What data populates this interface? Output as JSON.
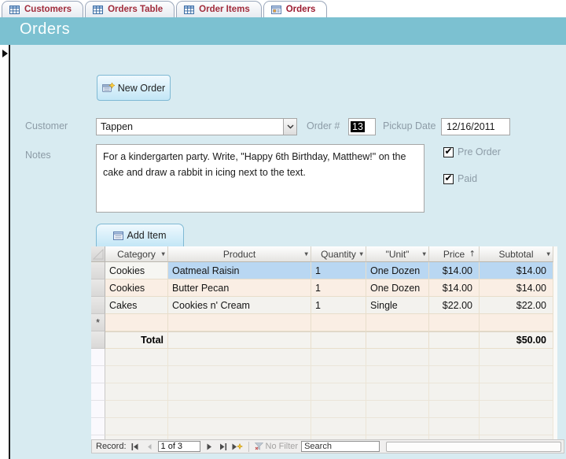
{
  "tabs": [
    {
      "label": "Customers",
      "icon": "table-icon",
      "active": false
    },
    {
      "label": "Orders Table",
      "icon": "table-icon",
      "active": false
    },
    {
      "label": "Order Items",
      "icon": "table-icon",
      "active": false
    },
    {
      "label": "Orders",
      "icon": "form-icon",
      "active": true
    }
  ],
  "header": {
    "title": "Orders"
  },
  "form": {
    "new_order_label": "New Order",
    "customer": {
      "label": "Customer",
      "value": "Tappen"
    },
    "order_number": {
      "label": "Order #",
      "value": "13"
    },
    "pickup_date": {
      "label": "Pickup Date",
      "value": "12/16/2011"
    },
    "notes": {
      "label": "Notes",
      "value": "For a kindergarten party. Write, \"Happy 6th Birthday, Matthew!\" on the cake and draw a rabbit in icing next to the text."
    },
    "checkboxes": [
      {
        "label": "Pre Order",
        "checked": true
      },
      {
        "label": "Paid",
        "checked": true
      }
    ],
    "add_item_label": "Add Item"
  },
  "table": {
    "columns": [
      "Category",
      "Product",
      "Quantity",
      "\"Unit\"",
      "Price",
      "Subtotal"
    ],
    "rows": [
      {
        "category": "Cookies",
        "product": "Oatmeal Raisin",
        "quantity": "1",
        "unit": "One Dozen",
        "price": "$14.00",
        "subtotal": "$14.00",
        "selected": true
      },
      {
        "category": "Cookies",
        "product": "Butter Pecan",
        "quantity": "1",
        "unit": "One Dozen",
        "price": "$14.00",
        "subtotal": "$14.00",
        "selected": false
      },
      {
        "category": "Cakes",
        "product": "Cookies n' Cream",
        "quantity": "1",
        "unit": "Single",
        "price": "$22.00",
        "subtotal": "$22.00",
        "selected": false
      }
    ],
    "new_row_marker": "*",
    "total": {
      "label": "Total",
      "value": "$50.00"
    }
  },
  "navbar": {
    "record_label": "Record:",
    "position": "1 of 3",
    "no_filter_label": "No Filter",
    "search_placeholder": "Search"
  },
  "icons": {
    "dropdown": "▼",
    "sort_ascending": "↑",
    "check": "✔"
  },
  "colors": {
    "accent_teal": "#7CC1D1",
    "form_background": "#D8EBF1",
    "selection_blue": "#B9D7F2",
    "row_alt_peach": "#FAEEE4",
    "row_alt_gray": "#F3F2EE",
    "tab_text_red": "#A12C3B",
    "button_blue": "#C3E6F6"
  }
}
